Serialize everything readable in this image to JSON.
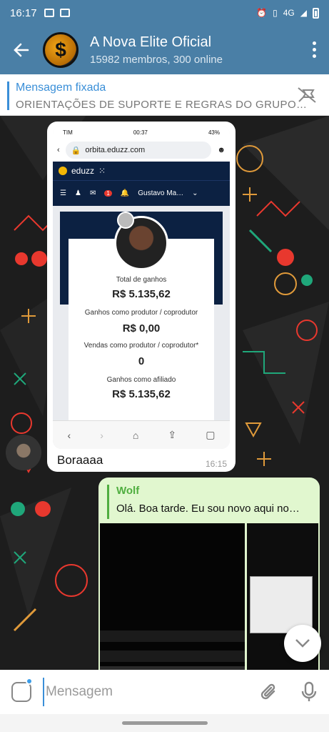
{
  "status_bar": {
    "time": "16:17",
    "network": "4G"
  },
  "header": {
    "title": "A Nova Elite Oficial",
    "subtitle": "15982 membros, 300 online"
  },
  "pinned": {
    "title": "Mensagem fixada",
    "text": "ORIENTAÇÕES DE SUPORTE E REGRAS DO GRUPO…"
  },
  "message_in": {
    "screenshot": {
      "carrier": "TIM",
      "time": "00:37",
      "battery": "43%",
      "url": "orbita.eduzz.com",
      "brand": "eduzz",
      "notification_count": "1",
      "user_name": "Gustavo Ma…",
      "total_label": "Total de ganhos",
      "total_value": "R$ 5.135,62",
      "producer_label": "Ganhos como produtor / coprodutor",
      "producer_value": "R$ 0,00",
      "sales_label": "Vendas como produtor / coprodutor*",
      "sales_value": "0",
      "affiliate_label": "Ganhos como afiliado",
      "affiliate_value": "R$ 5.135,62"
    },
    "caption": "Boraaaa",
    "time": "16:15"
  },
  "message_out": {
    "reply_name": "Wolf",
    "reply_text": "Olá. Boa tarde. Eu sou novo aqui no…"
  },
  "input": {
    "placeholder": "Mensagem"
  },
  "colors": {
    "header": "#4a7fa6",
    "accent": "#3a8fd8",
    "outgoing": "#e1f7cf",
    "reply_accent": "#4fae3f"
  }
}
